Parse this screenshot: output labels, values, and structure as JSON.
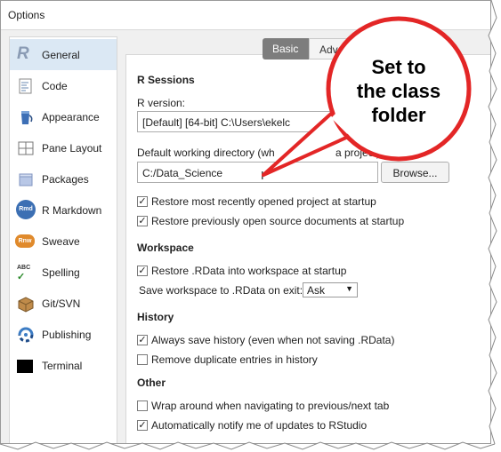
{
  "window": {
    "title": "Options"
  },
  "sidebar": {
    "items": [
      {
        "label": "General",
        "active": true
      },
      {
        "label": "Code"
      },
      {
        "label": "Appearance"
      },
      {
        "label": "Pane Layout"
      },
      {
        "label": "Packages"
      },
      {
        "label": "R Markdown"
      },
      {
        "label": "Sweave"
      },
      {
        "label": "Spelling"
      },
      {
        "label": "Git/SVN"
      },
      {
        "label": "Publishing"
      },
      {
        "label": "Terminal"
      }
    ],
    "icon_texts": {
      "r": "R",
      "rmd": "Rmd",
      "rnw": "Rnw",
      "abc": "ABC"
    }
  },
  "tabs": {
    "basic": "Basic",
    "advanced": "Adva"
  },
  "r_sessions": {
    "heading": "R Sessions",
    "r_version_label": "R version:",
    "r_version_value": "[Default] [64-bit] C:\\Users\\ekelc",
    "wd_label": "Default working directory (wh",
    "wd_label_tail": "a project):",
    "wd_value": "C:/Data_Science",
    "browse_label": "Browse...",
    "restore_project_label": "Restore most recently opened project at startup",
    "restore_project_checked": true,
    "restore_docs_label": "Restore previously open source documents at startup",
    "restore_docs_checked": true
  },
  "workspace": {
    "heading": "Workspace",
    "restore_rdata_label": "Restore .RData into workspace at startup",
    "restore_rdata_checked": true,
    "save_label": "Save workspace to .RData on exit:",
    "save_value": "Ask"
  },
  "history": {
    "heading": "History",
    "always_save_label": "Always save history (even when not saving .RData)",
    "always_save_checked": true,
    "remove_dup_label": "Remove duplicate entries in history",
    "remove_dup_checked": false
  },
  "other": {
    "heading": "Other",
    "wrap_label": "Wrap around when navigating to previous/next tab",
    "wrap_checked": false,
    "notify_label": "Automatically notify me of updates to RStudio",
    "notify_checked": true
  },
  "callout": {
    "line1": "Set to",
    "line2": "the class",
    "line3": "folder"
  },
  "colors": {
    "callout_border": "#e32626",
    "active_item": "#dbe8f4",
    "tab_selected": "#7d7d7d"
  }
}
